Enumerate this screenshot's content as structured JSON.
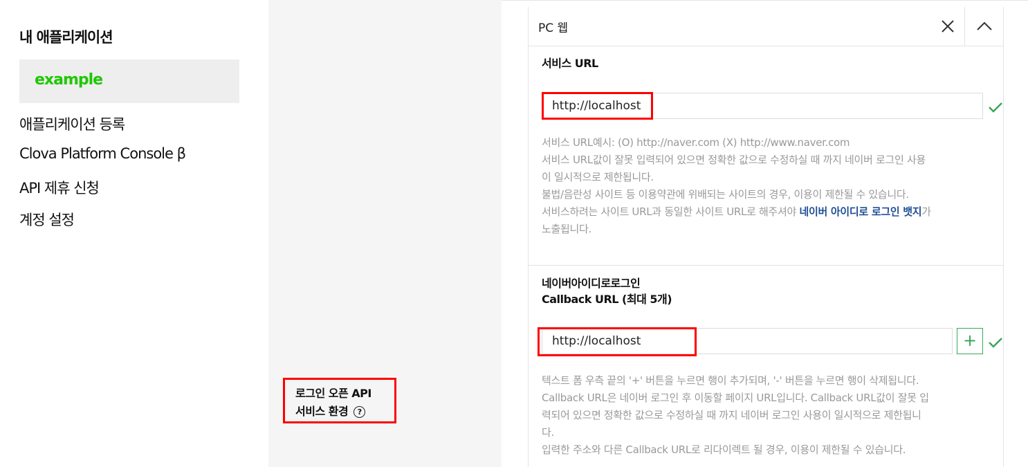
{
  "sidebar": {
    "title": "내 애플리케이션",
    "selected_app": "example",
    "items": [
      {
        "label": "애플리케이션 등록"
      },
      {
        "label": "Clova Platform Console β"
      },
      {
        "label": "API 제휴 신청"
      },
      {
        "label": "계정 설정"
      }
    ]
  },
  "env_label": {
    "line1": "로그인 오픈 API",
    "line2": "서비스 환경",
    "help_icon": "question-circle-icon"
  },
  "panel": {
    "title": "PC 웹",
    "close_icon": "close-icon",
    "collapse_icon": "chevron-up-icon"
  },
  "service_url": {
    "label": "서비스 URL",
    "value": "http://localhost",
    "check_icon": "check-icon",
    "help_lines": [
      "서비스 URL예시: (O) http://naver.com (X) http://www.naver.com",
      "서비스 URL값이 잘못 입력되어 있으면 정확한 값으로 수정하실 때 까지 네이버 로그인 사용",
      "이 일시적으로 제한됩니다.",
      "불법/음란성 사이트 등 이용약관에 위배되는 사이트의 경우, 이용이 제한될 수 있습니다."
    ],
    "help_last_prefix": "서비스하려는 사이트 URL과 동일한 사이트 URL로 해주셔야 ",
    "help_last_link": "네이버 아이디로 로그인 뱃지",
    "help_last_suffix": "가",
    "help_last_line2": "노출됩니다."
  },
  "callback_url": {
    "label_line1": "네이버아이디로로그인",
    "label_line2": "Callback URL (최대 5개)",
    "value": "http://localhost",
    "add_label": "+",
    "check_icon": "check-icon",
    "help_lines": [
      "텍스트 폼 우측 끝의 '+' 버튼을 누르면 행이 추가되며, '-' 버튼을 누르면 행이 삭제됩니다.",
      "Callback URL은 네이버 로그인 후 이동할 페이지 URL입니다. Callback URL값이 잘못 입",
      "력되어 있으면 정확한 값으로 수정하실 때 까지 네이버 로그인 사용이 일시적으로 제한됩니",
      "다.",
      "입력한 주소와 다른 Callback URL로 리다이렉트 될 경우, 이용이 제한될 수 있습니다."
    ]
  },
  "colors": {
    "brand_green": "#1ec800",
    "highlight_red": "#ff0000",
    "check_green": "#3aa65a",
    "link_blue": "#1f4e96"
  }
}
